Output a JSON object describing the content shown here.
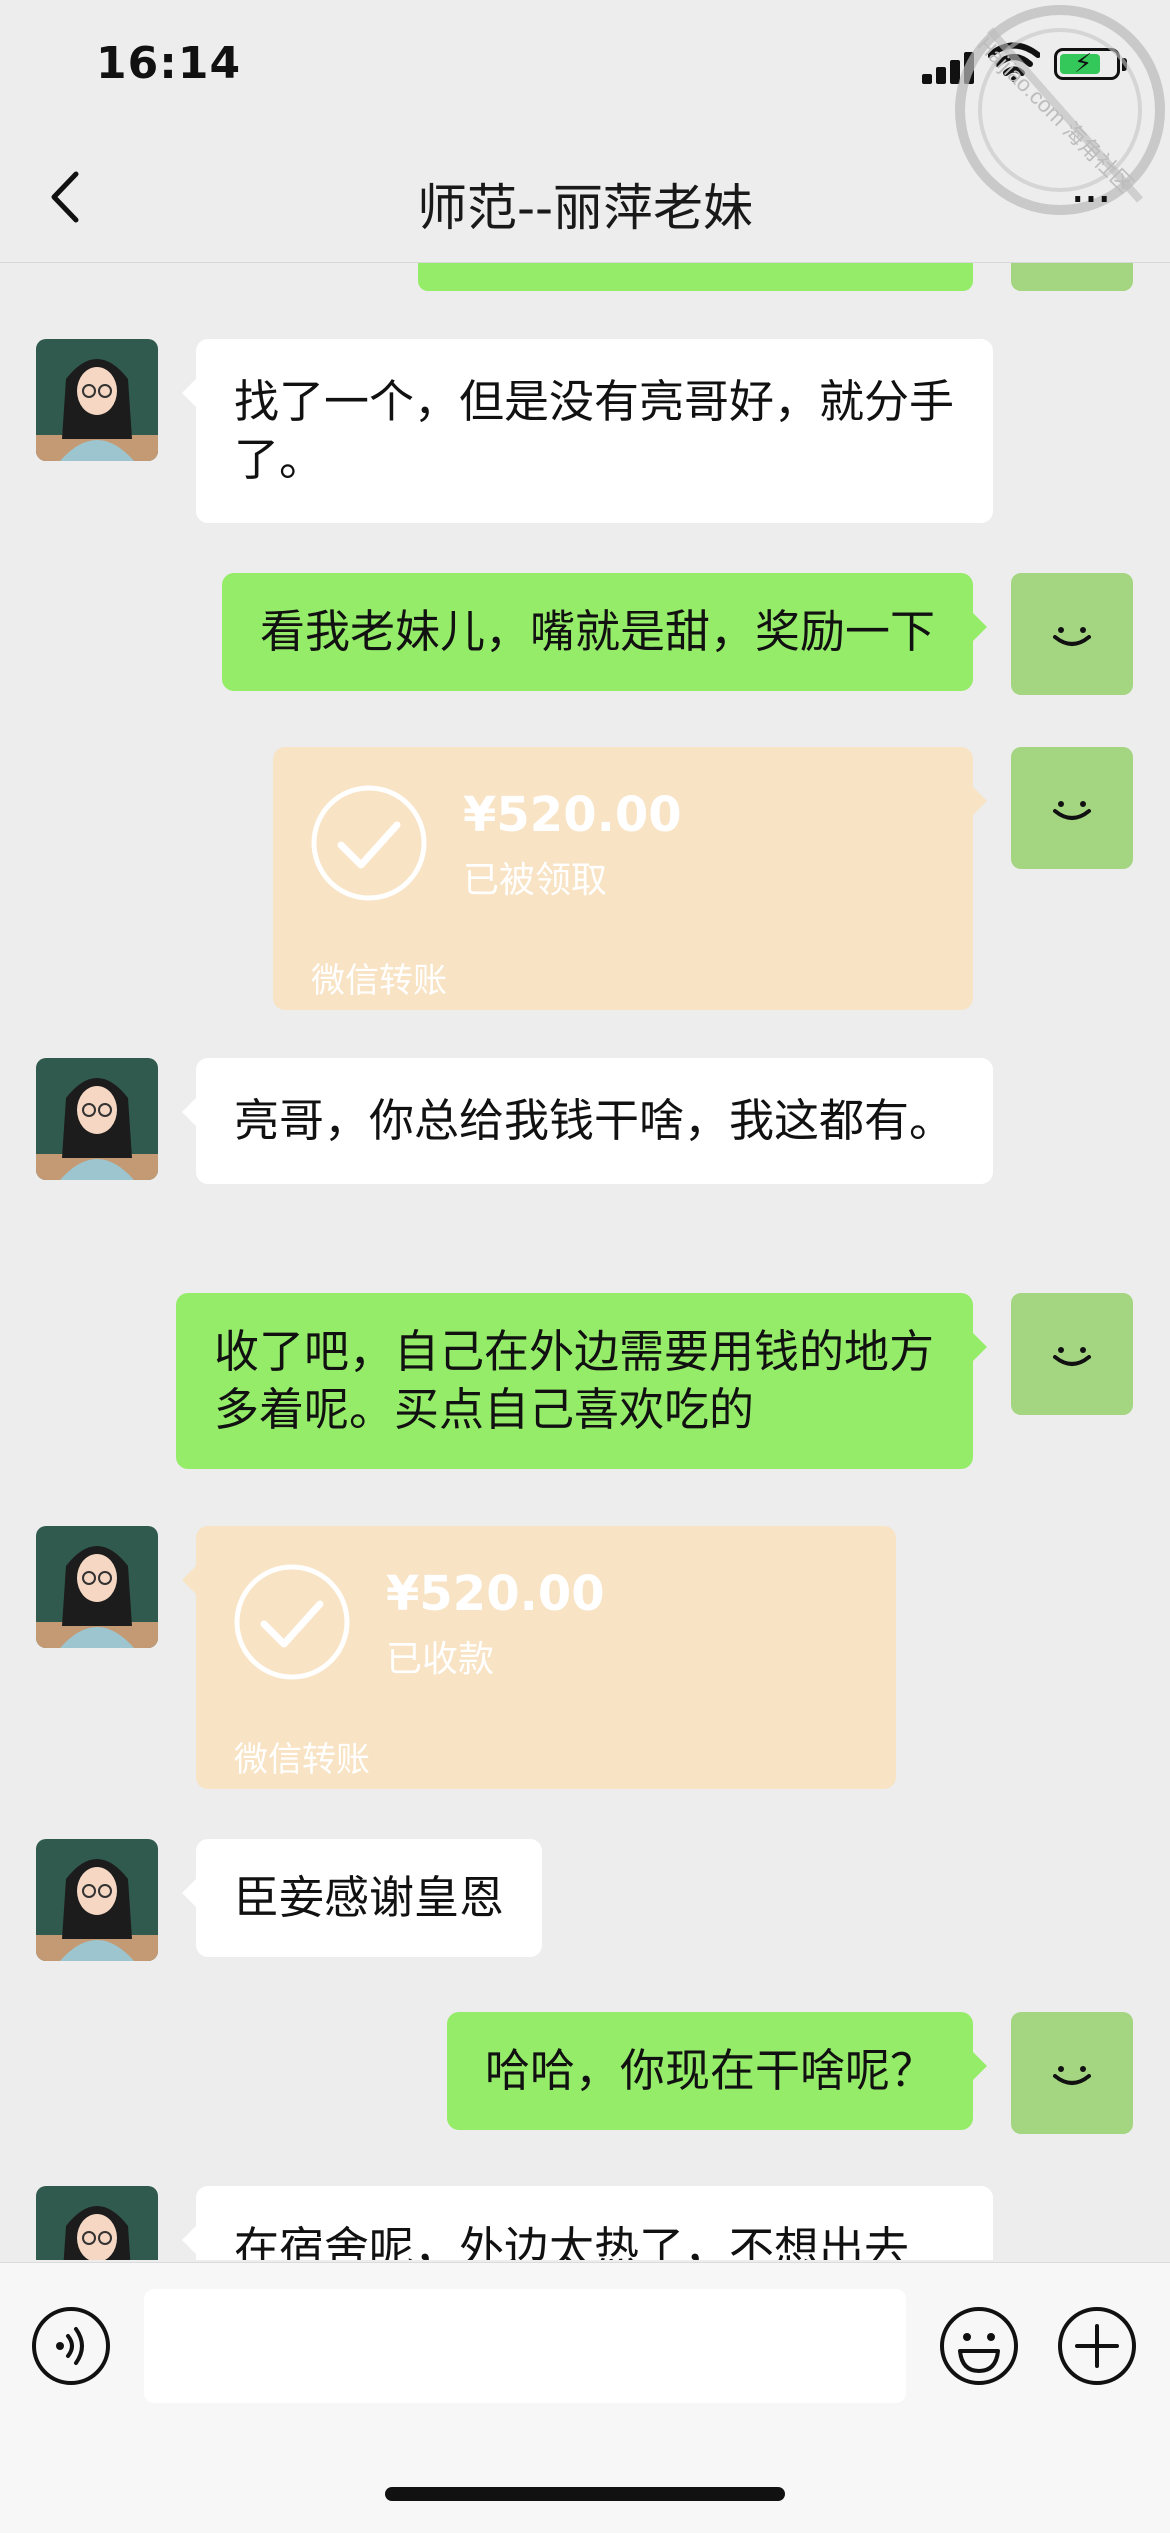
{
  "status_bar": {
    "time": "16:14"
  },
  "watermark": {
    "text": "Haijiao.com 海角社区"
  },
  "nav": {
    "title": "师范--丽萍老妹"
  },
  "messages": [
    {
      "side": "in",
      "text": "找了一个，但是没有亮哥好，就分手了。"
    },
    {
      "side": "out",
      "text": "看我老妹儿，嘴就是甜，奖励一下"
    },
    {
      "side": "out",
      "type": "transfer",
      "amount": "¥520.00",
      "status": "已被领取",
      "brand": "微信转账"
    },
    {
      "side": "in",
      "text": "亮哥，你总给我钱干啥，我这都有。"
    },
    {
      "side": "out",
      "text": "收了吧，自己在外边需要用钱的地方多着呢。买点自己喜欢吃的"
    },
    {
      "side": "in",
      "type": "transfer",
      "amount": "¥520.00",
      "status": "已收款",
      "brand": "微信转账"
    },
    {
      "side": "in",
      "text": "臣妾感谢皇恩"
    },
    {
      "side": "out",
      "text": "哈哈，你现在干啥呢？"
    },
    {
      "side": "in",
      "text": "在宿舍呢，外边太热了，不想出去"
    }
  ],
  "input": {
    "value": ""
  },
  "colors": {
    "out_bubble": "#95ec69",
    "in_bubble": "#ffffff",
    "transfer": "#f8e3c4",
    "self_avatar": "#a4d682"
  },
  "icons": [
    "back-icon",
    "more-icon",
    "voice-icon",
    "emoji-icon",
    "plus-icon",
    "check-icon",
    "smile-avatar-icon"
  ]
}
